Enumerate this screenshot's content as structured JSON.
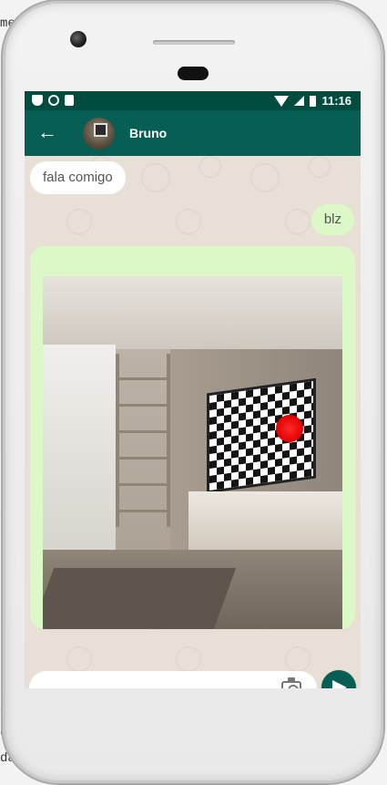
{
  "status_bar": {
    "time": "11:16"
  },
  "chat": {
    "contact_name": "Bruno",
    "messages": [
      {
        "direction": "in",
        "text": "fala comigo"
      },
      {
        "direction": "out",
        "text": "blz"
      },
      {
        "direction": "out",
        "type": "image"
      }
    ]
  },
  "composer": {
    "value": "",
    "placeholder": ""
  },
  "colors": {
    "primary": "#075e54",
    "status_bar": "#004d40",
    "outgoing_bubble": "#dcf8c6",
    "incoming_bubble": "#ffffff",
    "chat_background": "#e8e0d7"
  },
  "icons": {
    "back": "arrow-left-icon",
    "attach": "camera-icon",
    "send": "send-icon",
    "nav_back": "triangle-back-icon",
    "nav_home": "circle-home-icon",
    "nav_recent": "square-recent-icon"
  }
}
